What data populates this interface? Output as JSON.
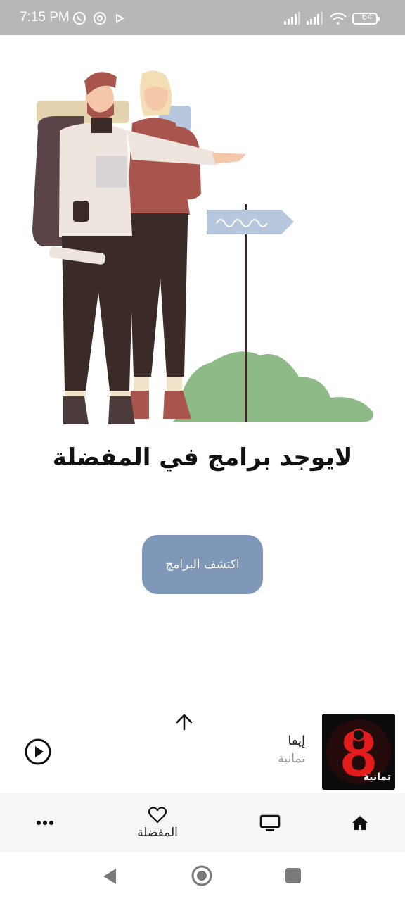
{
  "status_bar": {
    "time": "7:15 PM",
    "battery": "64",
    "icons": [
      "whatsapp-icon",
      "app-notification-icon",
      "play-store-icon",
      "signal-icon",
      "signal-icon-2",
      "wifi-icon",
      "battery-icon"
    ]
  },
  "empty_state": {
    "title": "لايوجد برامج في المفضلة",
    "discover_label": "اكتشف البرامج"
  },
  "mini_player": {
    "title": "إيفا",
    "subtitle": "تمانية",
    "cover_text": "تمانية"
  },
  "bottom_nav": {
    "favorites_label": "المفضلة"
  },
  "colors": {
    "accent": "#7f97b8",
    "status_bar": "#b7b7b7",
    "nav_bg": "#f6f6f6"
  }
}
